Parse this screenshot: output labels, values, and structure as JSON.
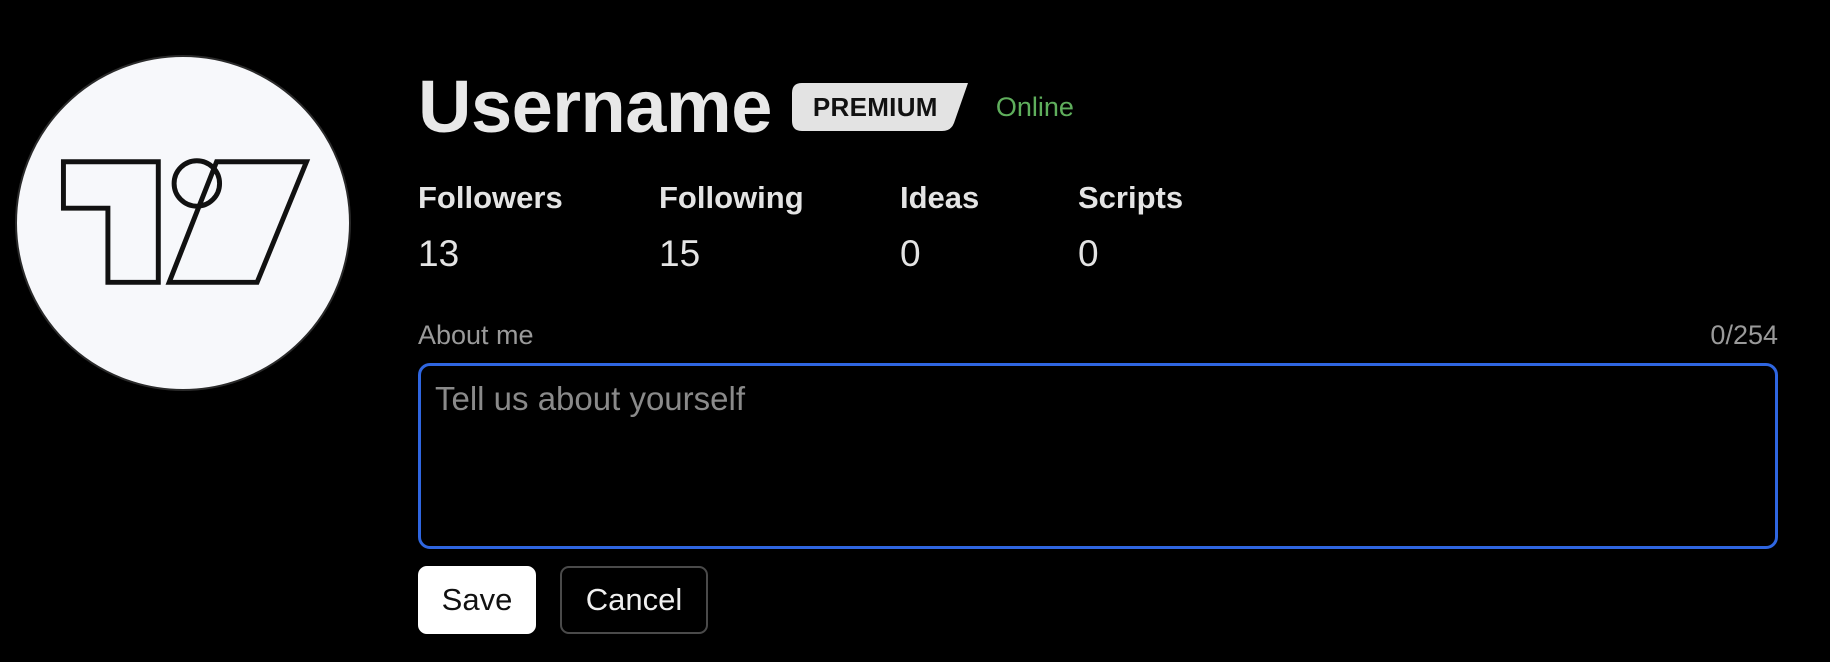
{
  "profile": {
    "username": "Username",
    "badge": "PREMIUM",
    "status": "Online",
    "avatar_icon": "tradingview-logo-icon"
  },
  "stats": [
    {
      "label": "Followers",
      "value": "13"
    },
    {
      "label": "Following",
      "value": "15"
    },
    {
      "label": "Ideas",
      "value": "0"
    },
    {
      "label": "Scripts",
      "value": "0"
    }
  ],
  "about": {
    "label": "About me",
    "counter": "0/254",
    "value": "",
    "placeholder": "Tell us about yourself"
  },
  "actions": {
    "save_label": "Save",
    "cancel_label": "Cancel"
  },
  "colors": {
    "background": "#000000",
    "status_online": "#5fae5c",
    "focus_border": "#2f66e0",
    "badge_bg": "#e3e3e3"
  }
}
